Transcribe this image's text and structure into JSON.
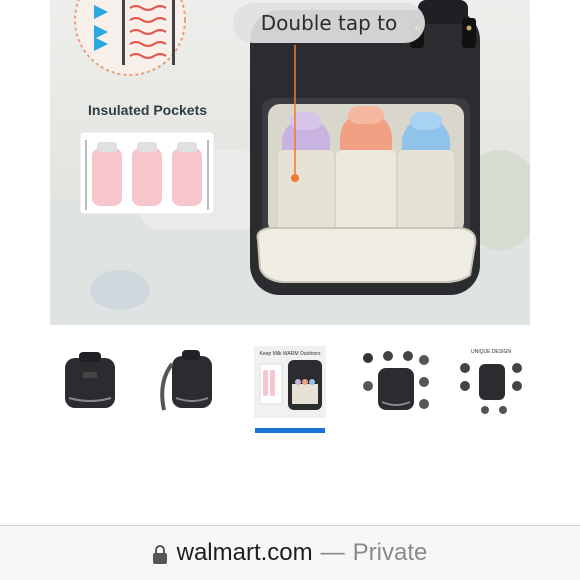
{
  "main_image": {
    "zoom_hint": "Double tap to zoom",
    "feature_label": "Insulated Pockets"
  },
  "thumbnails": [
    {
      "name": "front-view",
      "selected": false
    },
    {
      "name": "side-view",
      "selected": false
    },
    {
      "name": "keep-warm-outdoors",
      "selected": true,
      "caption": "Keep Milk WARM Outdoors"
    },
    {
      "name": "features",
      "selected": false
    },
    {
      "name": "unique-design",
      "selected": false,
      "caption": "UNIQUE DESIGN"
    }
  ],
  "url_bar": {
    "domain": "walmart.com",
    "separator": "—",
    "mode": "Private",
    "icon": "lock-icon"
  },
  "colors": {
    "selection": "#1a73d9",
    "bag": "#2a2c30"
  }
}
